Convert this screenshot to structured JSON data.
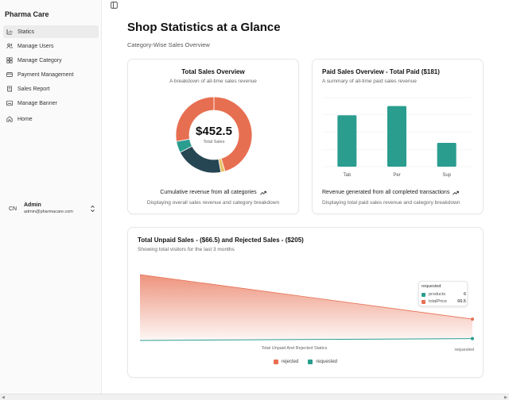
{
  "app": {
    "brand": "Pharma Care"
  },
  "sidebar": {
    "items": [
      {
        "label": "Statics",
        "icon": "chart-icon",
        "active": true
      },
      {
        "label": "Manage Users",
        "icon": "users-icon"
      },
      {
        "label": "Manage Category",
        "icon": "grid-icon"
      },
      {
        "label": "Payment Management",
        "icon": "card-icon"
      },
      {
        "label": "Sales Report",
        "icon": "receipt-icon"
      },
      {
        "label": "Manage Banner",
        "icon": "banner-icon"
      },
      {
        "label": "Home",
        "icon": "home-icon"
      }
    ],
    "user": {
      "initials": "CN",
      "name": "Admin",
      "email": "admin@pharmacare.com"
    }
  },
  "header": {
    "title": "Shop Statistics at a Glance",
    "subtitle": "Category-Wise Sales Overview"
  },
  "cards": {
    "total": {
      "title": "Total Sales Overview",
      "subtitle": "A breakdown of all-time sales revenue",
      "center_value": "$452.5",
      "center_label": "Total Sales",
      "footer_main": "Cumulative revenue from all categories",
      "footer_sub": "Displaying overall sales revenue and category breakdown"
    },
    "paid": {
      "title": "Paid Sales Overview - Total Paid ($181)",
      "subtitle": "A summary of all-time paid sales revenue",
      "footer_main": "Revenue generated from all completed transactions",
      "footer_sub": "Displaying total paid sales revenue and category breakdown"
    },
    "unpaid": {
      "title": "Total Unpaid Sales - ($66.5) and Rejected Sales - ($205)",
      "subtitle": "Showing total visitors for the last 3 months",
      "x_label": "Total Unpaid And Rejected Statics",
      "x_end_label": "requested",
      "tooltip": {
        "title": "requested",
        "rows": [
          {
            "name": "products",
            "value": "6",
            "color": "#2a9d8f"
          },
          {
            "name": "totalPrice",
            "value": "66.5",
            "color": "#e76f51"
          }
        ]
      },
      "legend": [
        {
          "label": "rejected",
          "color": "#e76f51"
        },
        {
          "label": "requested",
          "color": "#2a9d8f"
        }
      ]
    }
  },
  "colors": {
    "teal": "#2a9d8f",
    "orange": "#e76f51",
    "navy": "#264653",
    "yellow": "#e9c46a"
  },
  "chart_data": [
    {
      "type": "pie",
      "title": "Total Sales Overview",
      "center_value": "$452.5",
      "slices": [
        {
          "value": 205,
          "color": "#e76f51"
        },
        {
          "value": 8,
          "color": "#e9c46a"
        },
        {
          "value": 92,
          "color": "#264653"
        },
        {
          "value": 22,
          "color": "#2a9d8f"
        },
        {
          "value": 125.5,
          "color": "#e76f51"
        }
      ]
    },
    {
      "type": "bar",
      "title": "Paid Sales Overview - Total Paid ($181)",
      "categories": [
        "Tab",
        "Per",
        "Sup"
      ],
      "values": [
        67,
        79,
        31
      ],
      "ylim": [
        0,
        90
      ],
      "grid": true,
      "color": "#2a9d8f"
    },
    {
      "type": "area",
      "title": "Total Unpaid Sales - ($66.5) and Rejected Sales - ($205)",
      "x": [
        "rejected",
        "requested"
      ],
      "series": [
        {
          "name": "totalPrice",
          "values": [
            205,
            66.5
          ],
          "color": "#e76f51"
        },
        {
          "name": "products",
          "values": [
            0,
            6
          ],
          "color": "#2a9d8f"
        }
      ],
      "ylim": [
        0,
        205
      ]
    }
  ]
}
